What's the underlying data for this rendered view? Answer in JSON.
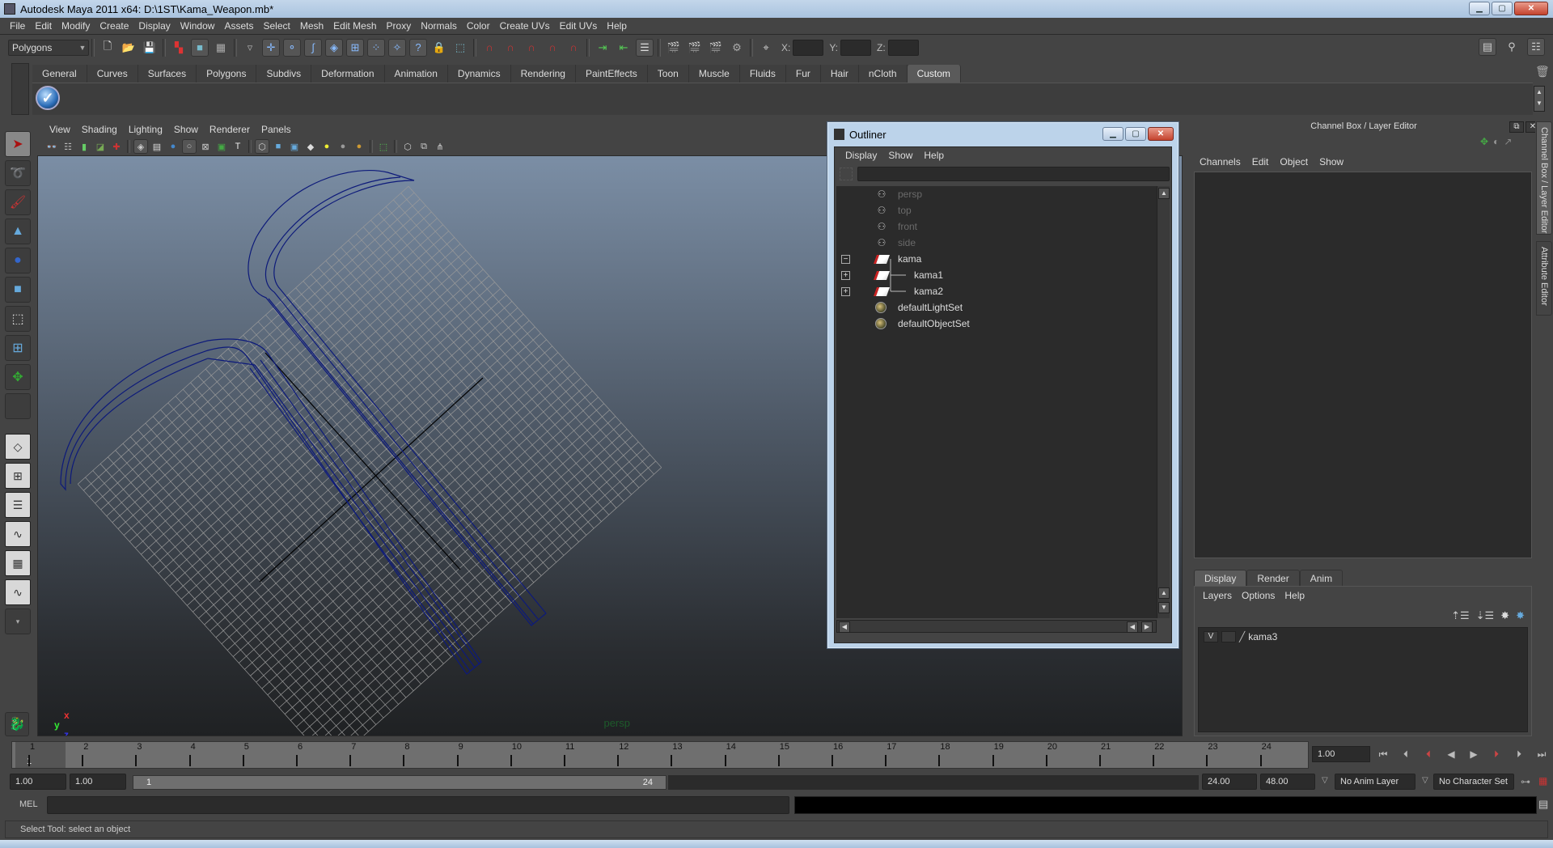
{
  "window": {
    "title": "Autodesk Maya 2011 x64: D:\\1ST\\Kama_Weapon.mb*"
  },
  "menubar": [
    "File",
    "Edit",
    "Modify",
    "Create",
    "Display",
    "Window",
    "Assets",
    "Select",
    "Mesh",
    "Edit Mesh",
    "Proxy",
    "Normals",
    "Color",
    "Create UVs",
    "Edit UVs",
    "Help"
  ],
  "statusline": {
    "mode": "Polygons",
    "x_label": "X:",
    "y_label": "Y:",
    "z_label": "Z:",
    "x_value": "",
    "y_value": "",
    "z_value": ""
  },
  "shelf": {
    "tabs": [
      "General",
      "Curves",
      "Surfaces",
      "Polygons",
      "Subdivs",
      "Deformation",
      "Animation",
      "Dynamics",
      "Rendering",
      "PaintEffects",
      "Toon",
      "Muscle",
      "Fluids",
      "Fur",
      "Hair",
      "nCloth",
      "Custom"
    ],
    "active_tab": "Custom"
  },
  "viewport": {
    "menu": [
      "View",
      "Shading",
      "Lighting",
      "Show",
      "Renderer",
      "Panels"
    ],
    "camera_label": "persp",
    "axis": {
      "x": "x",
      "y": "y",
      "z": "z"
    },
    "wireframe_color": "#0d1a7a"
  },
  "outliner": {
    "title": "Outliner",
    "menu": [
      "Display",
      "Show",
      "Help"
    ],
    "filter_value": "",
    "items": [
      {
        "label": "persp",
        "icon": "camera-icon",
        "dim": true,
        "expander": ""
      },
      {
        "label": "top",
        "icon": "camera-icon",
        "dim": true,
        "expander": ""
      },
      {
        "label": "front",
        "icon": "camera-icon",
        "dim": true,
        "expander": ""
      },
      {
        "label": "side",
        "icon": "camera-icon",
        "dim": true,
        "expander": ""
      },
      {
        "label": "kama",
        "icon": "transform-icon",
        "dim": false,
        "expander": "−"
      },
      {
        "label": "kama1",
        "icon": "transform-icon",
        "dim": false,
        "expander": "+"
      },
      {
        "label": "kama2",
        "icon": "transform-icon",
        "dim": false,
        "expander": "+"
      },
      {
        "label": "defaultLightSet",
        "icon": "set-icon",
        "dim": false,
        "expander": ""
      },
      {
        "label": "defaultObjectSet",
        "icon": "set-icon",
        "dim": false,
        "expander": ""
      }
    ]
  },
  "channelbox": {
    "header": "Channel Box / Layer Editor",
    "menu": [
      "Channels",
      "Edit",
      "Object",
      "Show"
    ]
  },
  "side_tabs": [
    "Channel Box / Layer Editor",
    "Attribute Editor"
  ],
  "layer_editor": {
    "tabs": [
      "Display",
      "Render",
      "Anim"
    ],
    "active_tab": "Display",
    "menu": [
      "Layers",
      "Options",
      "Help"
    ],
    "layers": [
      {
        "visible": "V",
        "type": "",
        "name": "kama3"
      }
    ]
  },
  "timeline": {
    "ticks": [
      "1",
      "2",
      "3",
      "4",
      "5",
      "6",
      "7",
      "8",
      "9",
      "10",
      "11",
      "12",
      "13",
      "14",
      "15",
      "16",
      "17",
      "18",
      "19",
      "20",
      "21",
      "22",
      "23",
      "24"
    ],
    "current_frame": "1",
    "current_time": "1.00",
    "start_time": "1.00",
    "playback_start": "1.00",
    "range_start_label": "1",
    "range_end_label": "24",
    "playback_end": "24.00",
    "end_time": "48.00",
    "anim_layer": "No Anim Layer",
    "character_set": "No Character Set"
  },
  "commandline": {
    "label": "MEL",
    "input": "",
    "output": ""
  },
  "helpline": {
    "text": "Select Tool: select an object"
  }
}
